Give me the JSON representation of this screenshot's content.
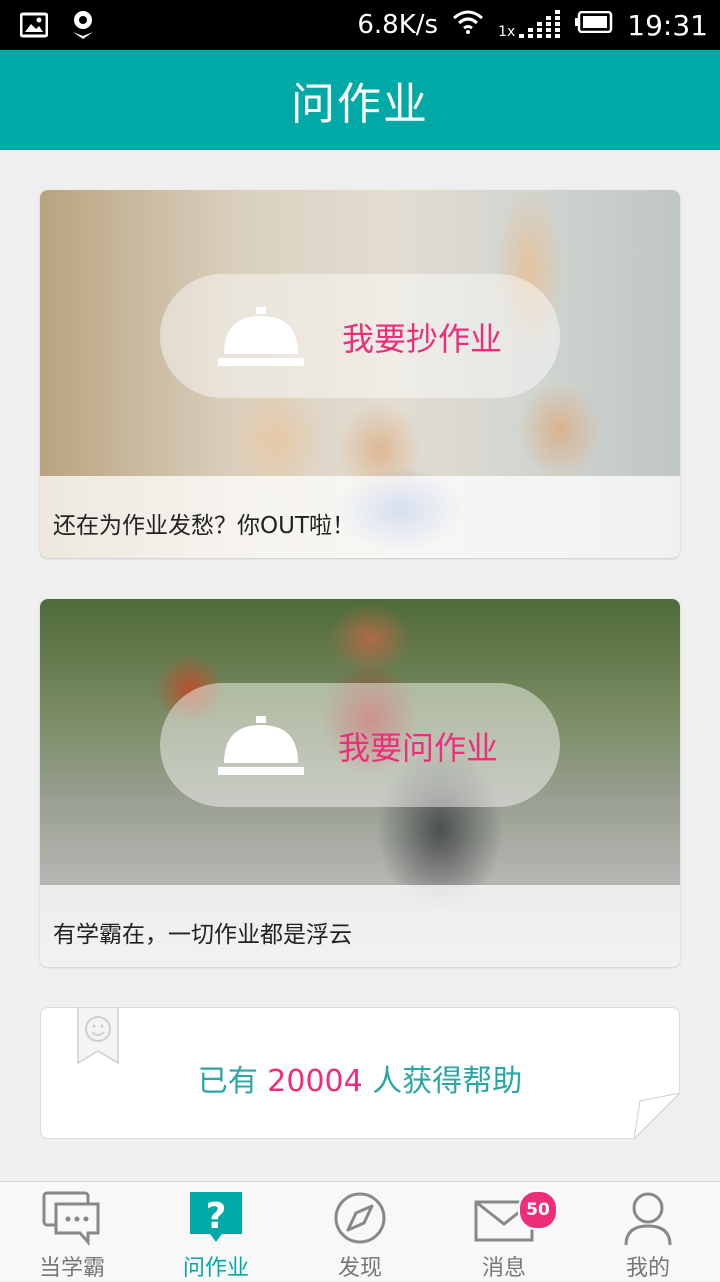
{
  "status_bar": {
    "speed": "6.8K/s",
    "signal_label": "1x",
    "time": "19:31",
    "icons": [
      "image-icon",
      "location-icon",
      "wifi-icon",
      "signal-icon",
      "battery-icon"
    ]
  },
  "header": {
    "title": "问作业"
  },
  "cards": [
    {
      "action_label": "我要抄作业",
      "caption": "还在为作业发愁？你OUT啦！",
      "icon": "service-bell-icon"
    },
    {
      "action_label": "我要问作业",
      "caption": "有学霸在，一切作业都是浮云",
      "icon": "service-bell-icon"
    }
  ],
  "help_banner": {
    "prefix": "已有 ",
    "count": "20004",
    "suffix": " 人获得帮助"
  },
  "bottom_nav": {
    "items": [
      {
        "label": "当学霸",
        "icon": "chat-bubble-icon"
      },
      {
        "label": "问作业",
        "icon": "question-icon"
      },
      {
        "label": "发现",
        "icon": "compass-icon"
      },
      {
        "label": "消息",
        "icon": "mail-icon",
        "badge": "50"
      },
      {
        "label": "我的",
        "icon": "user-icon"
      }
    ],
    "active_index": 1
  },
  "colors": {
    "accent": "#00a9a6",
    "highlight": "#ee2d7b"
  }
}
